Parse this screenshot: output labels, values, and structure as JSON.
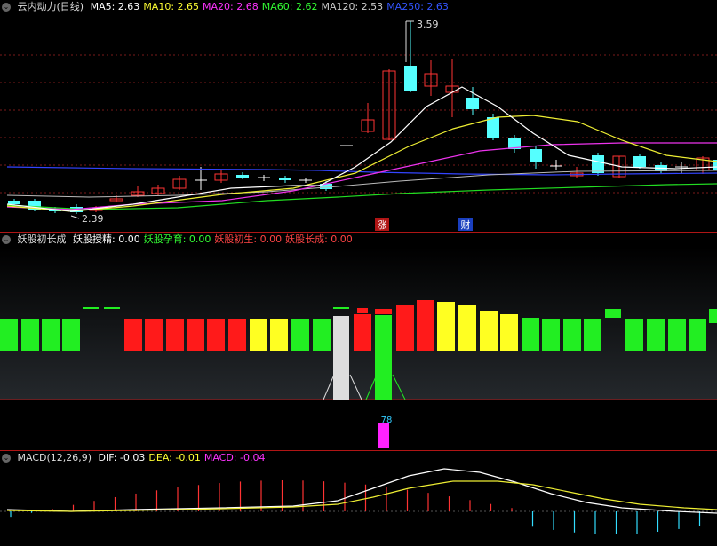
{
  "panel1": {
    "title": "云内动力(日线)",
    "ma": [
      {
        "label": "MA5:",
        "value": "2.63",
        "color": "#ffffff"
      },
      {
        "label": "MA10:",
        "value": "2.65",
        "color": "#ffff33"
      },
      {
        "label": "MA20:",
        "value": "2.68",
        "color": "#ff33ff"
      },
      {
        "label": "MA60:",
        "value": "2.62",
        "color": "#33ff33"
      },
      {
        "label": "MA120:",
        "value": "2.53",
        "color": "#cccccc"
      },
      {
        "label": "MA250:",
        "value": "2.63",
        "color": "#3355ff"
      }
    ],
    "high_label": "3.59",
    "low_label": "2.39",
    "markers": [
      {
        "text": "涨"
      },
      {
        "text": "财"
      }
    ]
  },
  "panel2": {
    "title": "妖股初长成",
    "items": [
      {
        "label": "妖股授精:",
        "value": "0.00",
        "color": "#ffffff"
      },
      {
        "label": "妖股孕育:",
        "value": "0.00",
        "color": "#33ff33"
      },
      {
        "label": "妖股初生:",
        "value": "0.00",
        "color": "#ff4444"
      },
      {
        "label": "妖股长成:",
        "value": "0.00",
        "color": "#ff4444"
      }
    ],
    "signal_value": "78",
    "colors": {
      "green": "#22ee22",
      "red": "#ff1a1a",
      "yellow": "#ffff22",
      "white": "#dddddd",
      "magenta": "#ff22ff"
    }
  },
  "panel3": {
    "title": "MACD(12,26,9)",
    "items": [
      {
        "label": "DIF:",
        "value": "-0.03",
        "color": "#ffffff"
      },
      {
        "label": "DEA:",
        "value": "-0.01",
        "color": "#ffff33"
      },
      {
        "label": "MACD:",
        "value": "-0.04",
        "color": "#ff33ff"
      }
    ]
  }
}
